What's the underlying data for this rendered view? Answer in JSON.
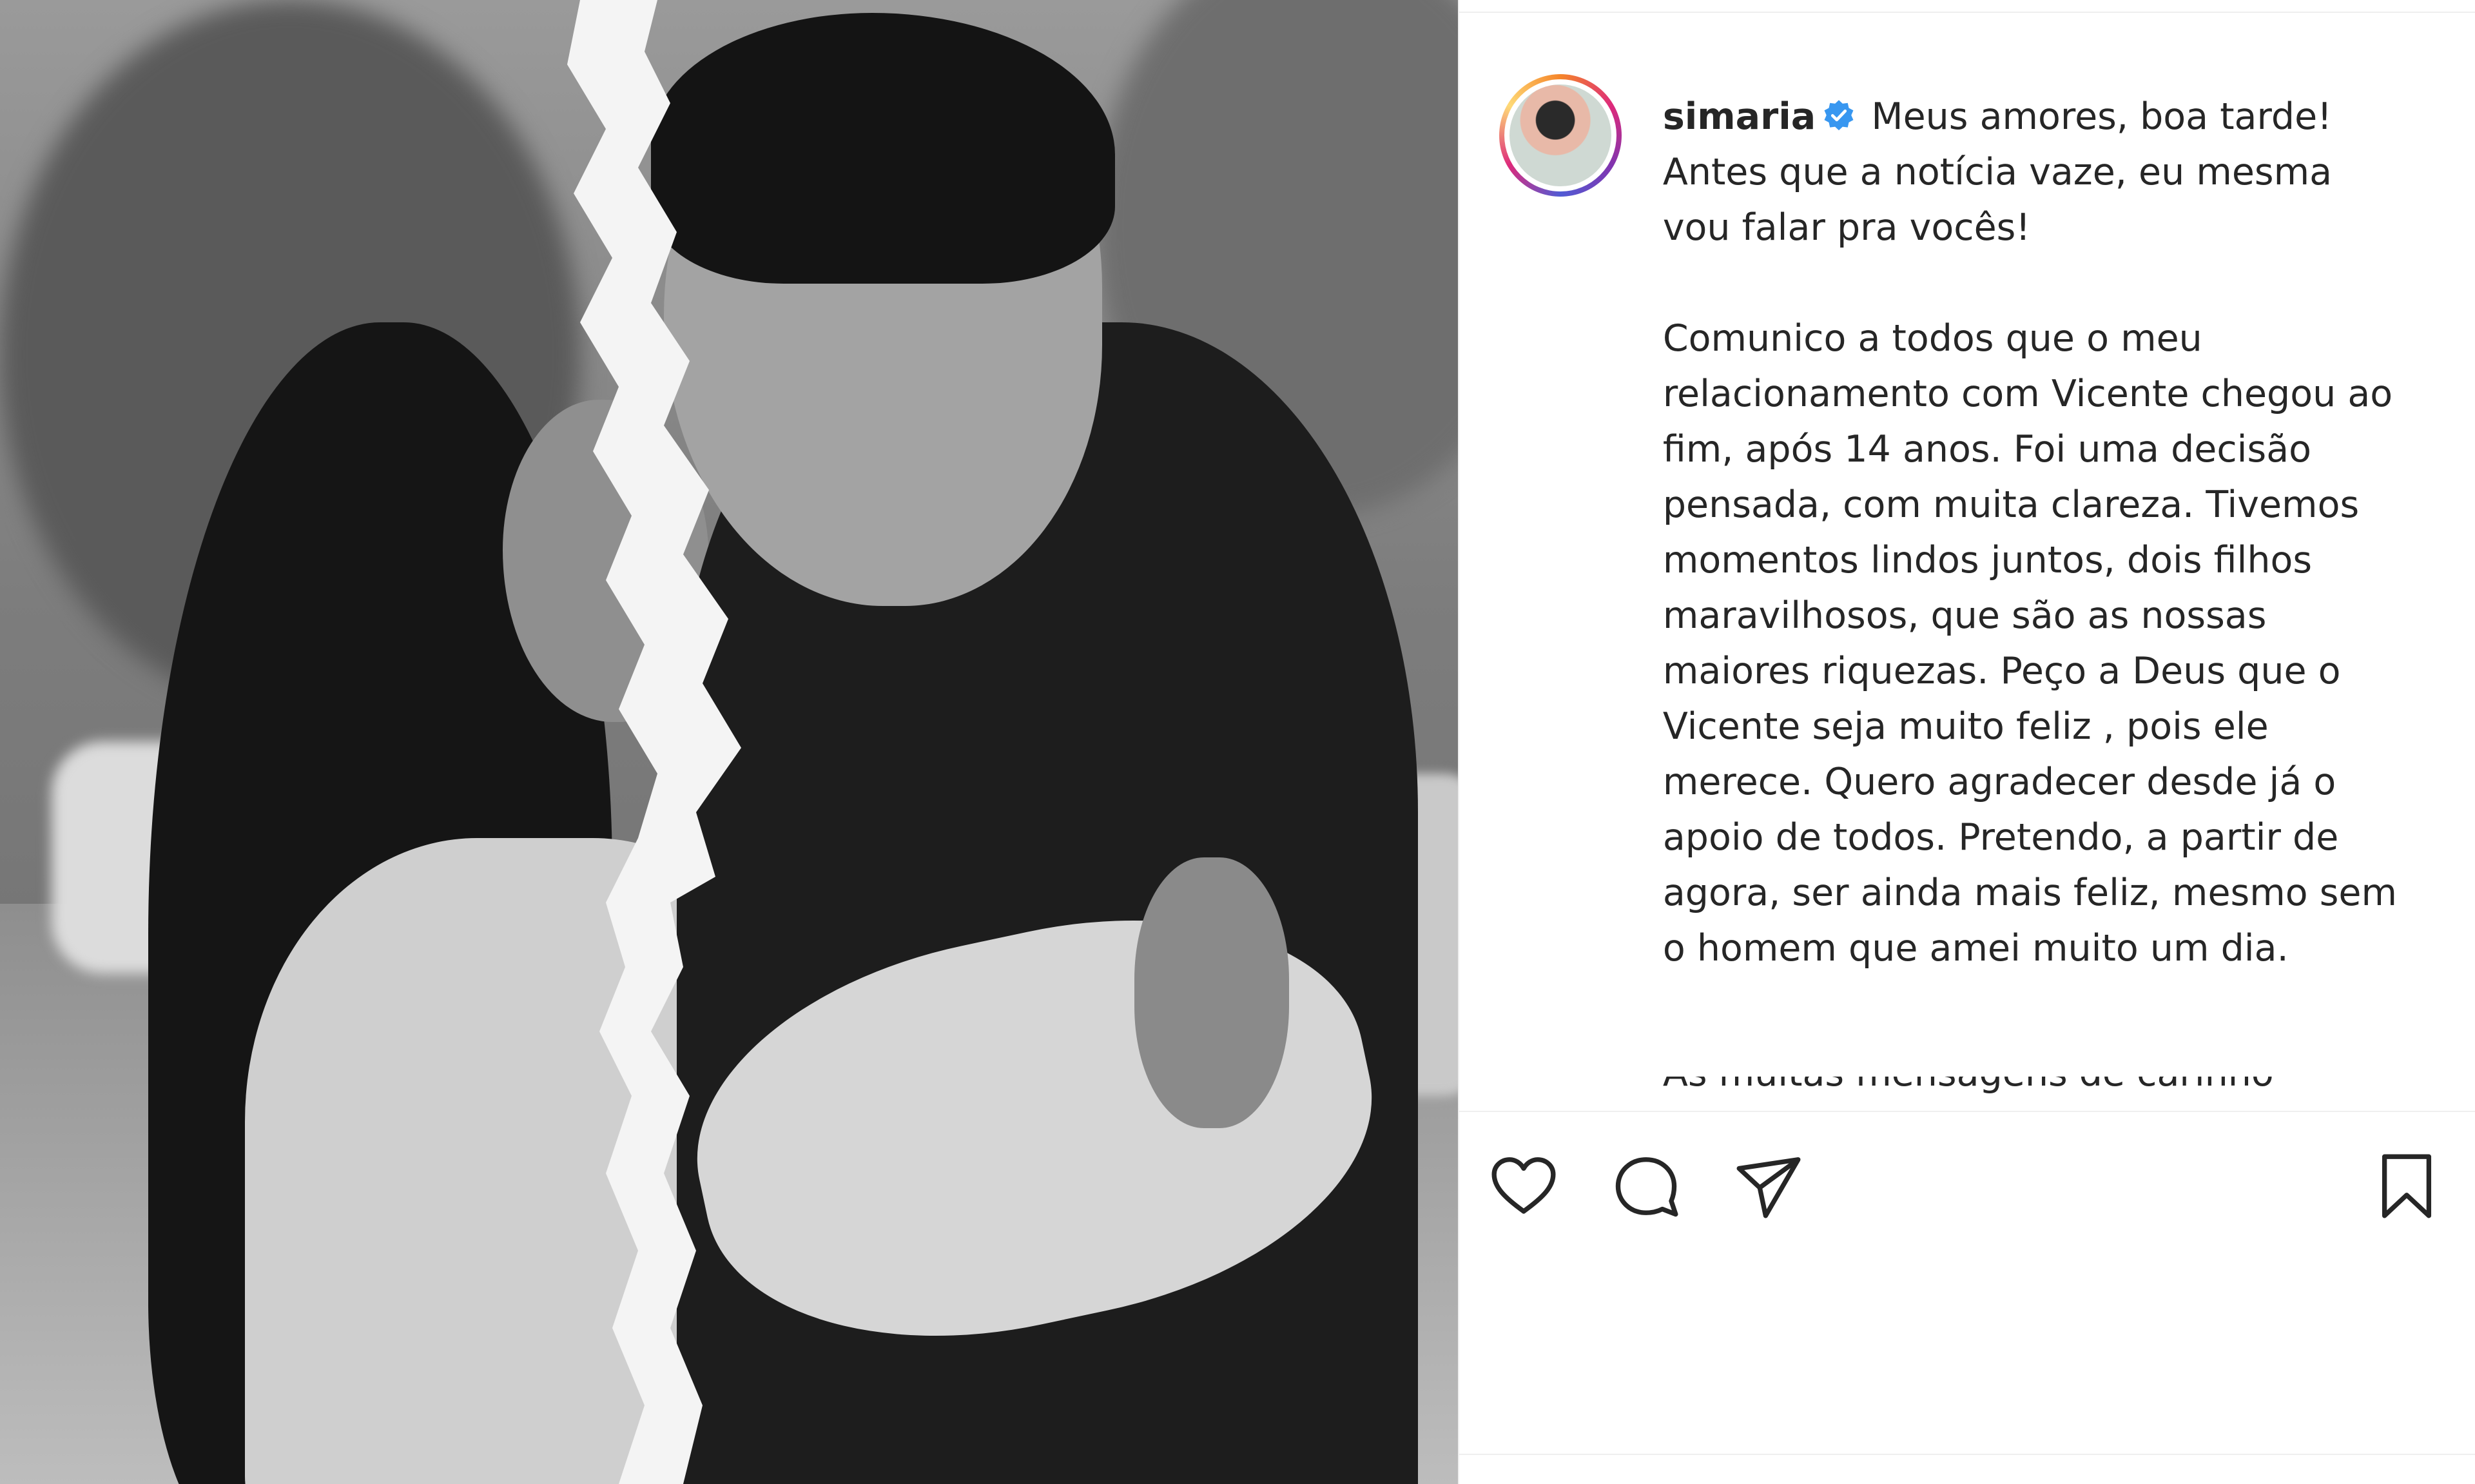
{
  "post": {
    "username": "simaria",
    "verified": true,
    "caption_paragraphs": [
      "Meus amores, boa tarde! Antes que a notícia vaze, eu mesma vou falar pra vocês!",
      "Comunico a todos que o meu relacionamento com Vicente chegou ao fim, após 14 anos. Foi uma decisão pensada, com muita clareza. Tivemos momentos lindos juntos, dois filhos maravilhosos, que são as nossas maiores riquezas. Peço a Deus que o Vicente seja muito feliz , pois ele merece. Quero agradecer desde já o apoio de todos. Pretendo, a partir de agora, ser ainda mais feliz, mesmo sem o homem que amei muito um dia."
    ],
    "caption_cut_line": "As muitas mensagens de carinho"
  },
  "icons": {
    "like": "heart-icon",
    "comment": "comment-icon",
    "share": "paper-plane-icon",
    "save": "bookmark-icon",
    "verified": "verified-badge-icon"
  },
  "colors": {
    "verified": "#3897f0",
    "text": "#262626",
    "divider": "#efefef"
  }
}
